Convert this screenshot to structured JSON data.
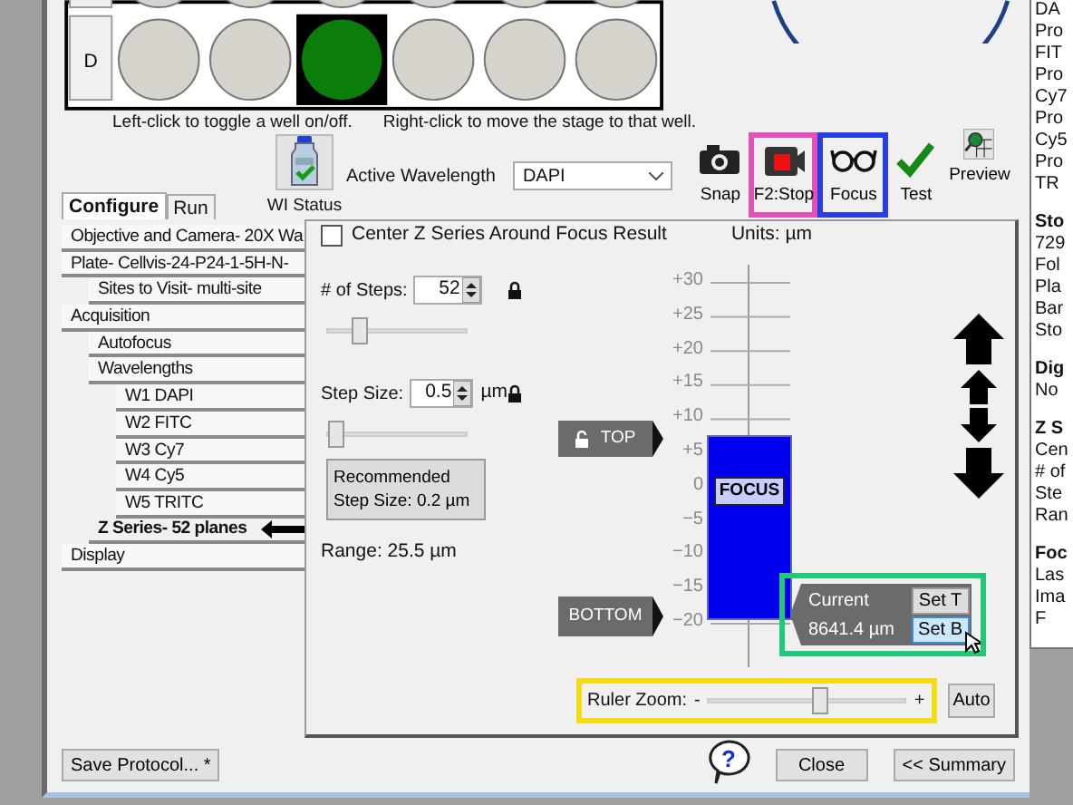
{
  "plate": {
    "rows": [
      {
        "wells": [
          {
            "on": false
          },
          {
            "on": false
          },
          {
            "on": false
          },
          {
            "on": false
          },
          {
            "on": false
          },
          {
            "on": false
          }
        ]
      },
      {
        "label": "D",
        "wells": [
          {
            "on": false
          },
          {
            "on": false
          },
          {
            "on": true
          },
          {
            "on": false
          },
          {
            "on": false
          },
          {
            "on": false
          }
        ]
      }
    ]
  },
  "hints": [
    "Left-click to toggle a well on/off.",
    "Right-click to move the stage to that well."
  ],
  "wl_status": {
    "label": "WI Status"
  },
  "active_wavelength": {
    "label": "Active Wavelength",
    "value": "DAPI"
  },
  "tools": [
    {
      "kind": "snap",
      "label": "Snap"
    },
    {
      "kind": "stop",
      "label": "F2:Stop",
      "color": "#e052b8"
    },
    {
      "kind": "focus",
      "label": "Focus",
      "color": "#2a3ee0"
    },
    {
      "kind": "test",
      "label": "Test"
    },
    {
      "kind": "preview",
      "label": "Preview"
    }
  ],
  "tabs": [
    {
      "label": "Configure",
      "selected": true
    },
    {
      "label": "Run",
      "selected": false
    }
  ],
  "tree": [
    {
      "label": "Objective and Camera- 20X Wa",
      "selected": false
    },
    {
      "label": "Plate- Cellvis-24-P24-1-5H-N-",
      "selected": false,
      "children": [
        {
          "label": "Sites to Visit- multi-site",
          "selected": false
        }
      ]
    },
    {
      "label": "Acquisition",
      "selected": false,
      "children": [
        {
          "label": "Autofocus",
          "selected": false
        },
        {
          "label": "Wavelengths",
          "selected": false,
          "children": [
            {
              "label": "W1 DAPI",
              "selected": false
            },
            {
              "label": "W2 FITC",
              "selected": false
            },
            {
              "label": "W3 Cy7",
              "selected": false
            },
            {
              "label": "W4 Cy5",
              "selected": false
            },
            {
              "label": "W5 TRITC",
              "selected": false
            }
          ]
        },
        {
          "label": "Z Series- 52 planes",
          "selected": true
        }
      ]
    },
    {
      "label": "Display",
      "selected": false
    }
  ],
  "z_series": {
    "center_label": "Center Z Series Around Focus Result",
    "center_checked": false,
    "steps_label": "# of Steps:",
    "steps_value": "52",
    "steps_slider": {
      "level": 0.22
    },
    "size_label": "Step Size:",
    "size_value": "0.5",
    "size_unit": "µm",
    "size_slider": {
      "level": 0.0
    },
    "recommended": "Recommended Step Size: 0.2 µm",
    "range": "Range: 25.5 µm"
  },
  "ruler": {
    "units": "Units: µm",
    "ticks": [
      "+30",
      "+25",
      "+20",
      "+15",
      "+10",
      "+5",
      "0",
      "−5",
      "−10",
      "−15",
      "−20"
    ],
    "focus": "FOCUS",
    "top": "TOP",
    "bottom": "BOTTOM",
    "current": {
      "label": "Current",
      "value": "8641.4 µm",
      "color": "#22c77a",
      "buttons": [
        {
          "label": "Set T",
          "hovered": false
        },
        {
          "label": "Set B",
          "hovered": true
        }
      ]
    },
    "zoom": {
      "label": "Ruler Zoom:",
      "minus": "-",
      "plus": "+",
      "level": 0.56,
      "color": "#f2dc14"
    },
    "auto": "Auto"
  },
  "footer": {
    "save": "Save Protocol... *",
    "help": "?",
    "close": "Close",
    "summary": "<< Summary"
  },
  "info_panel": [
    {
      "lines": [
        "DA",
        "Pro",
        "FIT",
        "Pro",
        "Cy7",
        "Pro",
        "Cy5",
        "Pro",
        "TR"
      ]
    },
    {
      "heading": "Sto",
      "lines": [
        "729",
        "Fol",
        "Pla",
        "Bar",
        "Sto"
      ]
    },
    {
      "heading": "Dig",
      "lines": [
        "No"
      ]
    },
    {
      "heading": "Z S",
      "lines": [
        "Cen",
        "# of",
        "Ste",
        "Ran"
      ]
    },
    {
      "heading": "Foc",
      "lines": [
        "Las",
        "Ima",
        "F"
      ]
    }
  ]
}
